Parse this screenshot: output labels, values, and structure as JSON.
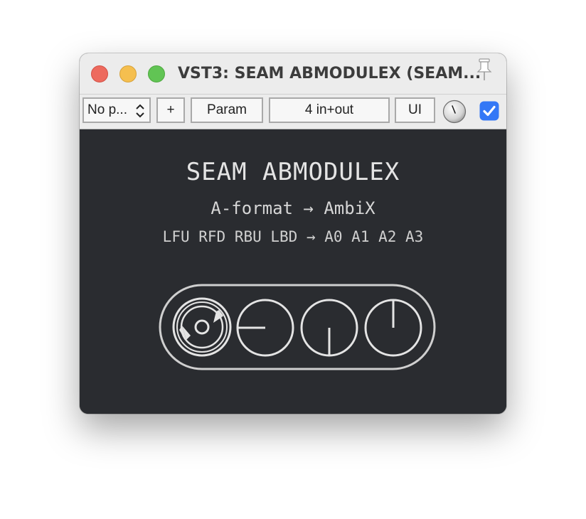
{
  "window": {
    "title": "VST3: SEAM ABMODULEX (SEAM..."
  },
  "toolbar": {
    "preset_value": "No p...",
    "add_label": "+",
    "param_label": "Param",
    "io_label": "4 in+out",
    "ui_label": "UI",
    "enabled_checked": true,
    "accent_color": "#3478f6"
  },
  "plugin": {
    "name": "SEAM ABMODULEX",
    "conversion": "A-format → AmbiX",
    "channel_map": "LFU RFD RBU LBD → A0 A1 A2 A3",
    "background_color": "#2a2c30",
    "icons": [
      "ambisonic-mic-icon",
      "dial-left-icon",
      "dial-down-icon",
      "dial-up-icon"
    ]
  }
}
